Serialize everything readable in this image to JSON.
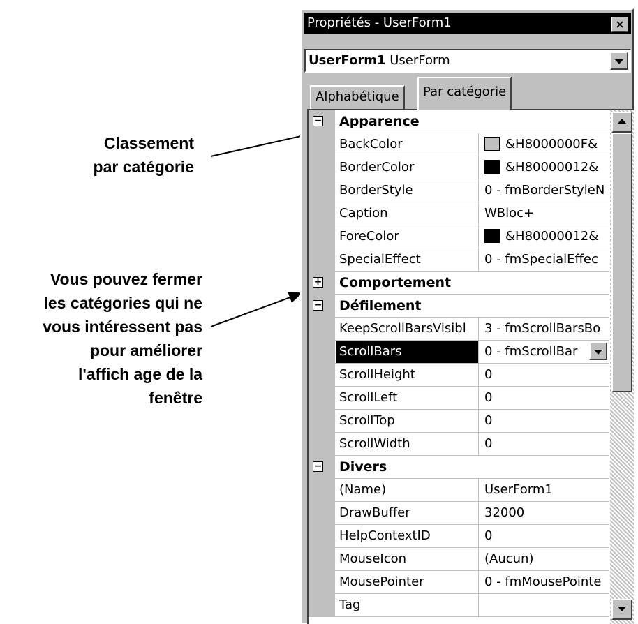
{
  "annotations": {
    "category_note": [
      "Classement",
      "par catégorie"
    ],
    "collapse_note": [
      "Vous pouvez fermer",
      "les catégories qui ne",
      "vous intéressent pas",
      "pour améliorer",
      "l'affich age de la",
      "fenêtre"
    ]
  },
  "window": {
    "title": "Propriétés - UserForm1",
    "close_glyph": "×",
    "object_name": "UserForm1",
    "object_type": "UserForm"
  },
  "tabs": {
    "alphabetic": "Alphabétique",
    "by_category": "Par catégorie"
  },
  "colors": {
    "backcolor_swatch": "#c0c0c0",
    "black_swatch": "#000000",
    "selection": "#000000"
  },
  "rows": [
    {
      "type": "category",
      "expander": "−",
      "name": "Apparence"
    },
    {
      "type": "prop",
      "name": "BackColor",
      "value": "&H8000000F&",
      "swatch": "#c0c0c0"
    },
    {
      "type": "prop",
      "name": "BorderColor",
      "value": "&H80000012&",
      "swatch": "#000000"
    },
    {
      "type": "prop",
      "name": "BorderStyle",
      "value": "0 - fmBorderStyleN"
    },
    {
      "type": "prop",
      "name": "Caption",
      "value": "WBloc+"
    },
    {
      "type": "prop",
      "name": "ForeColor",
      "value": "&H80000012&",
      "swatch": "#000000"
    },
    {
      "type": "prop",
      "name": "SpecialEffect",
      "value": "0 - fmSpecialEffec"
    },
    {
      "type": "category",
      "expander": "+",
      "name": "Comportement"
    },
    {
      "type": "category",
      "expander": "−",
      "name": "Défilement"
    },
    {
      "type": "prop",
      "name": "KeepScrollBarsVisibl",
      "value": "3 - fmScrollBarsBo"
    },
    {
      "type": "prop",
      "name": "ScrollBars",
      "value": "0 - fmScrollBar",
      "selected": true
    },
    {
      "type": "prop",
      "name": "ScrollHeight",
      "value": "0"
    },
    {
      "type": "prop",
      "name": "ScrollLeft",
      "value": "0"
    },
    {
      "type": "prop",
      "name": "ScrollTop",
      "value": "0"
    },
    {
      "type": "prop",
      "name": "ScrollWidth",
      "value": "0"
    },
    {
      "type": "category",
      "expander": "−",
      "name": "Divers"
    },
    {
      "type": "prop",
      "name": "(Name)",
      "value": "UserForm1"
    },
    {
      "type": "prop",
      "name": "DrawBuffer",
      "value": "32000"
    },
    {
      "type": "prop",
      "name": "HelpContextID",
      "value": "0"
    },
    {
      "type": "prop",
      "name": "MouseIcon",
      "value": "(Aucun)"
    },
    {
      "type": "prop",
      "name": "MousePointer",
      "value": "0 - fmMousePointe"
    },
    {
      "type": "prop",
      "name": "Tag",
      "value": ""
    }
  ]
}
